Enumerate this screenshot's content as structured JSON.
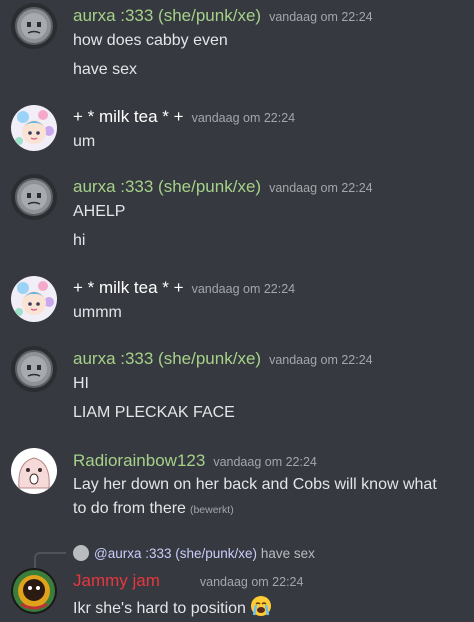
{
  "messages": [
    {
      "username": "aurxa :333 (she/punk/xe)",
      "timestamp": "vandaag om 22:24",
      "lines": [
        "how does cabby even",
        "have sex"
      ]
    },
    {
      "username": "+ * milk tea * +",
      "timestamp": "vandaag om 22:24",
      "lines": [
        "um"
      ]
    },
    {
      "username": "aurxa :333 (she/punk/xe)",
      "timestamp": "vandaag om 22:24",
      "lines": [
        "AHELP",
        "hi"
      ]
    },
    {
      "username": "+ * milk tea * +",
      "timestamp": "vandaag om 22:24",
      "lines": [
        "ummm"
      ]
    },
    {
      "username": "aurxa :333 (she/punk/xe)",
      "timestamp": "vandaag om 22:24",
      "lines": [
        "HI",
        "LIAM PLECKAK FACE"
      ]
    },
    {
      "username": "Radiorainbow123",
      "timestamp": "vandaag om 22:24",
      "lines": [
        "Lay her down on her back and Cobs will know what",
        "to do from there"
      ],
      "edited": "(bewerkt)"
    },
    {
      "reply": {
        "mention": "@aurxa :333 (she/punk/xe)",
        "text": "have sex"
      },
      "username": "Jammy jam",
      "timestamp": "vandaag om 22:24",
      "lines": [
        "Ikr she's hard to position"
      ]
    }
  ],
  "colors": {
    "background": "#36393f",
    "aurxa": "#a6d189",
    "milktea": "#ffffff",
    "radiorainbow": "#a6d189",
    "jammy": "#e8373e"
  },
  "icons": {
    "emoji": "crying-face-emoji"
  }
}
